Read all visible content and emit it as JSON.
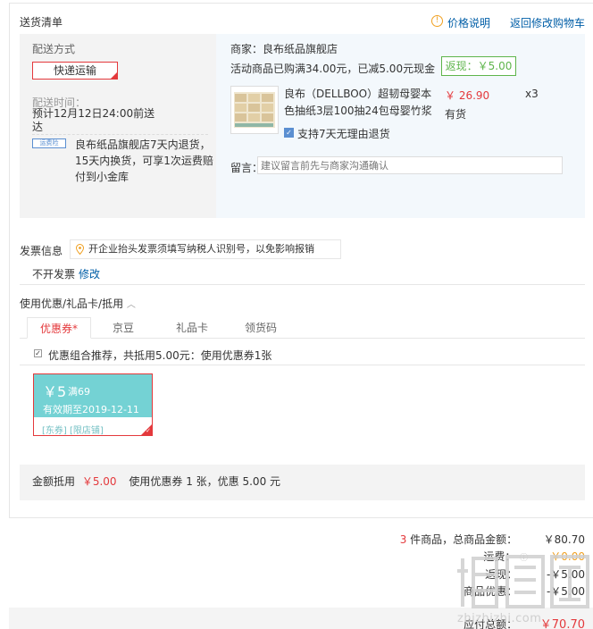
{
  "section": {
    "title": "送货清单",
    "price_note": "价格说明",
    "back_to_cart": "返回修改购物车"
  },
  "delivery": {
    "method_label": "配送方式",
    "method_value": "快递运输",
    "time_label": "配送时间：",
    "time_value": "预计12月12日24:00前送达",
    "service_badge": "运费险",
    "service_text": "良布纸品旗舰店7天内退货，15天内换货，可享1次运费赔付到小金库"
  },
  "shop": {
    "name_label": "商家：良布纸品旗舰店",
    "promo_text": "活动商品已购满34.00元，已减5.00元现金",
    "rebate": "返现：￥5.00",
    "product_title": "良布（DELLBOO）超韧母婴本色抽纸3层100抽24包母婴竹浆",
    "price": "￥ 26.90",
    "quantity": "x3",
    "stock": "有货",
    "return_policy": "支持7天无理由退货",
    "remark_label": "留言：",
    "remark_placeholder": "建议留言前先与商家沟通确认"
  },
  "invoice": {
    "label": "发票信息",
    "tip": "开企业抬头发票须填写纳税人识别号，以免影响报销",
    "value": "不开发票",
    "edit": "修改"
  },
  "coupons": {
    "title": "使用优惠/礼品卡/抵用",
    "tabs": [
      "优惠券*",
      "京豆",
      "礼品卡",
      "领货码"
    ],
    "recommend_text": "优惠组合推荐，共抵用5.00元：使用优惠券1张",
    "card": {
      "amount": "￥5",
      "condition": "满69",
      "expiry": "有效期至2019-12-11",
      "tags": "[东券]  [限店铺]"
    },
    "summary_label": "金额抵用",
    "summary_amount": "￥5.00",
    "summary_detail": "使用优惠券 1 张，优惠 5.00 元"
  },
  "totals": {
    "count": "3",
    "count_suffix": "件商品，总商品金额：",
    "goods_amount": "￥80.70",
    "shipping_label": "运费：",
    "shipping_amount": "￥0.00",
    "rebate_label": "返现：",
    "rebate_amount": "-￥5.00",
    "discount_label": "商品优惠：",
    "discount_amount": "-￥5.00",
    "payable_label": "应付总额：",
    "payable_amount": "￥70.70"
  },
  "watermark": {
    "site": "zhizhizhi.com"
  },
  "colors": {
    "accent_red": "#e4393c",
    "link_blue": "#005ea7",
    "rebate_green": "#5eb54b",
    "coupon_teal": "#74d2d4"
  }
}
